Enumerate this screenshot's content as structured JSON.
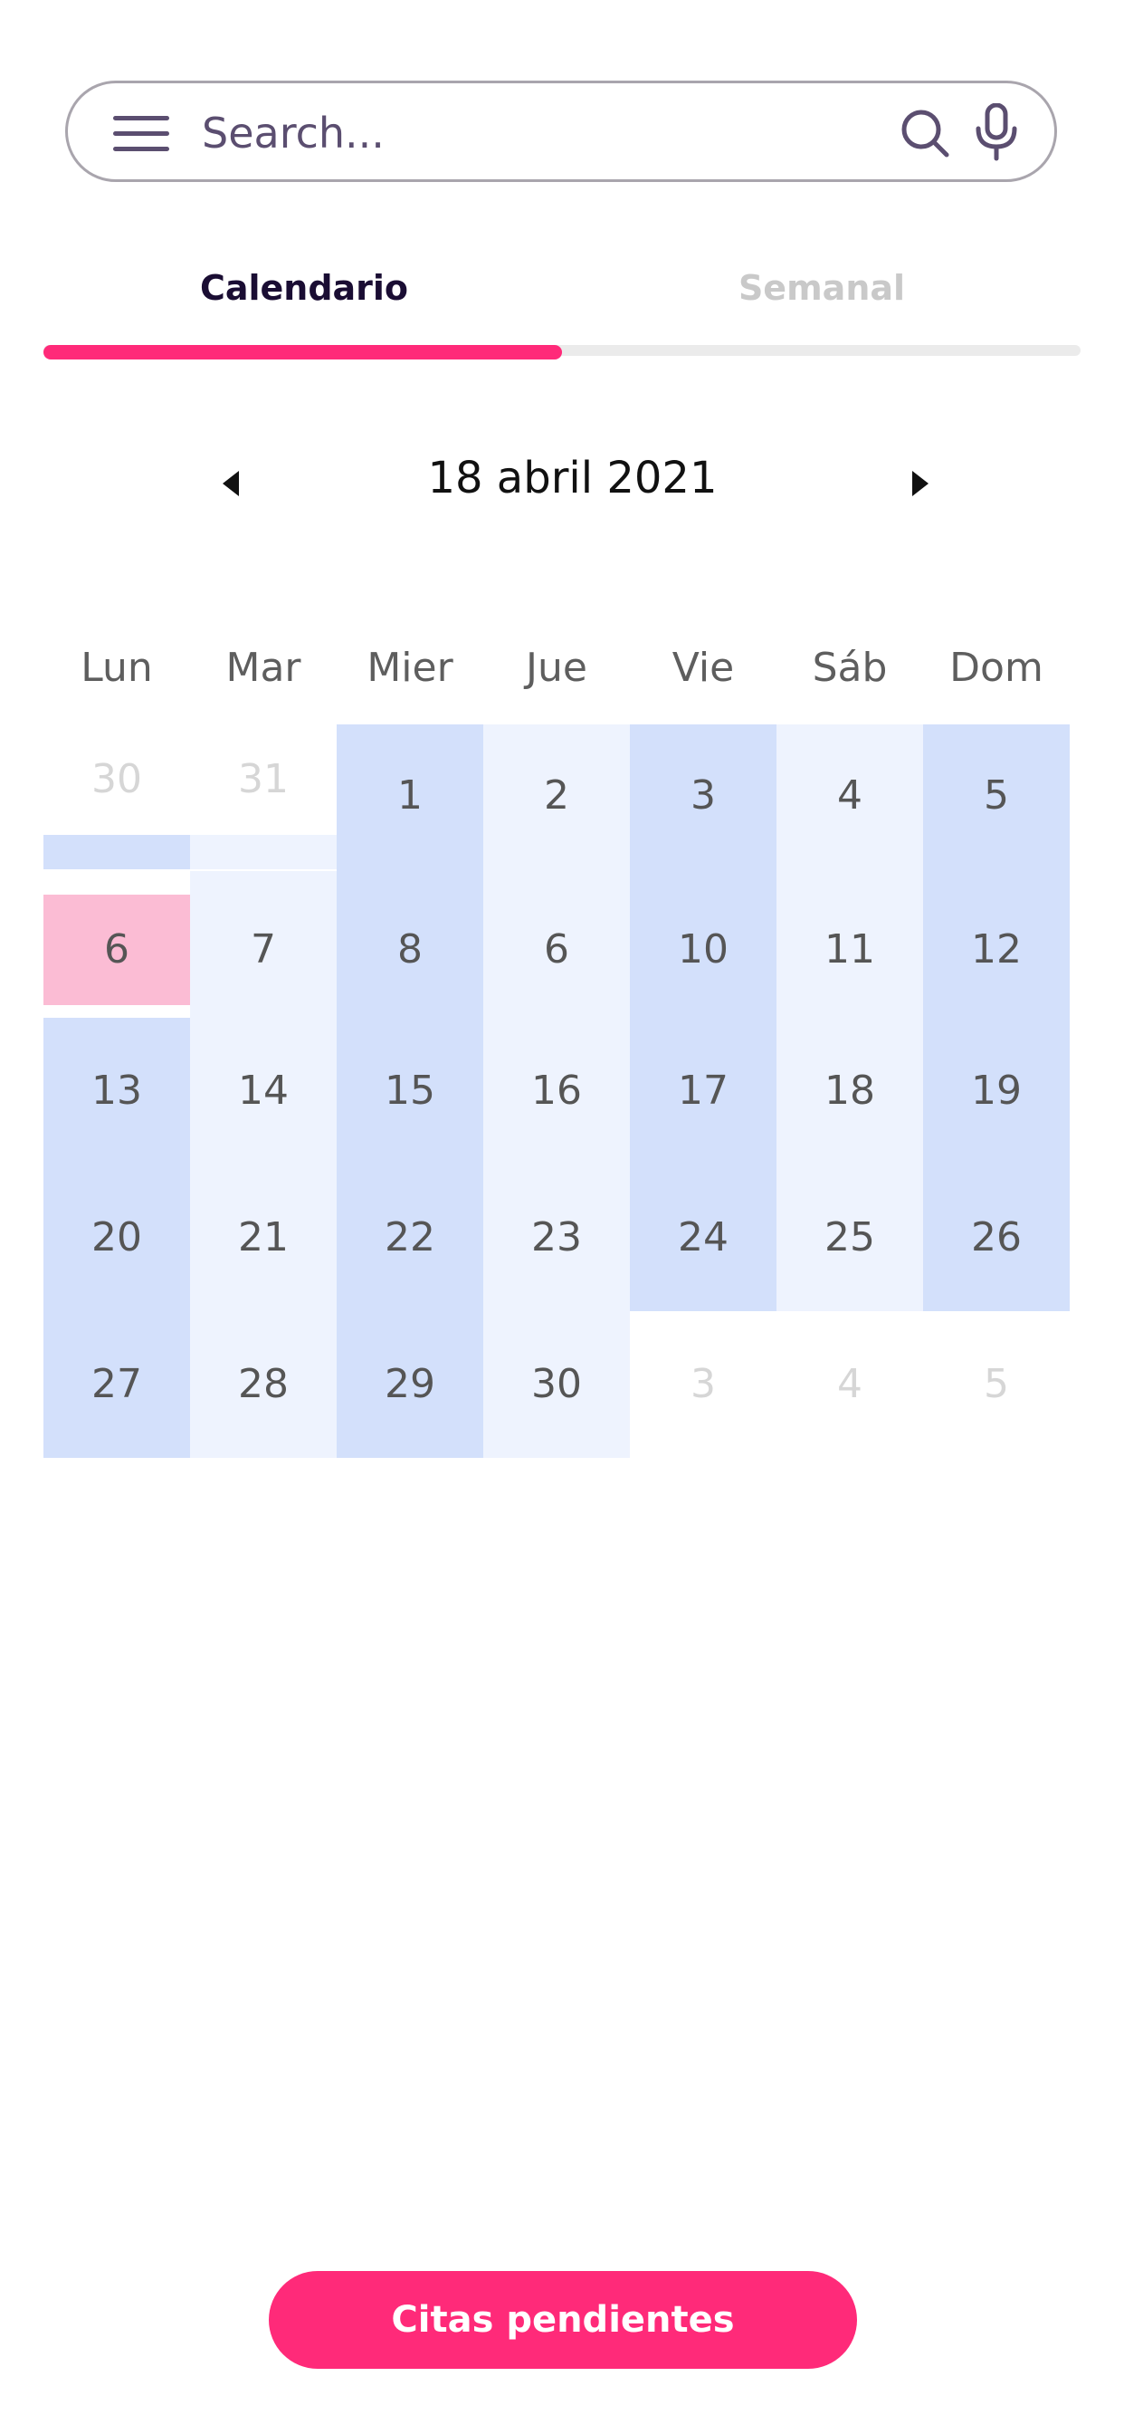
{
  "search": {
    "placeholder": "Search..."
  },
  "tabs": [
    {
      "label": "Calendario",
      "active": true
    },
    {
      "label": "Semanal",
      "active": false
    }
  ],
  "calendar": {
    "month_label": "18 abril 2021",
    "weekdays": [
      "Lun",
      "Mar",
      "Mier",
      "Jue",
      "Vie",
      "Sáb",
      "Dom"
    ],
    "weeks": [
      [
        "30",
        "31",
        "1",
        "2",
        "3",
        "4",
        "5"
      ],
      [
        "6",
        "7",
        "8",
        "6",
        "10",
        "11",
        "12"
      ],
      [
        "13",
        "14",
        "15",
        "16",
        "17",
        "18",
        "19"
      ],
      [
        "20",
        "21",
        "22",
        "23",
        "24",
        "25",
        "26"
      ],
      [
        "27",
        "28",
        "29",
        "30",
        "3",
        "4",
        "5"
      ]
    ],
    "selected_day": "6"
  },
  "colors": {
    "accent": "#ff2a79",
    "cell_dark": "#d3e0fb",
    "cell_light": "#eef3fe",
    "selected_cell": "#fbbcd4"
  },
  "footer": {
    "pending_button_label": "Citas pendientes"
  }
}
